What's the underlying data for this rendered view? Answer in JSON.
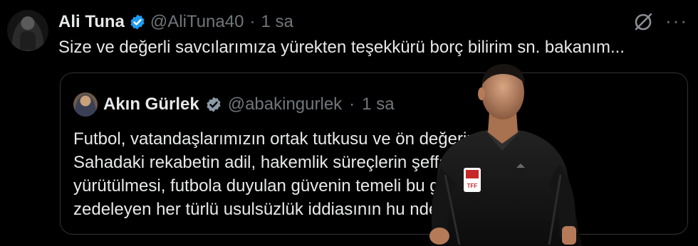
{
  "tweet": {
    "author_name": "Ali Tuna",
    "handle": "@AliTuna40",
    "separator": "·",
    "time": "1 sa",
    "text": "Size ve değerli savcılarımıza yürekten teşekkürü borç bilirim sn. bakanım...",
    "more_label": "···"
  },
  "quote": {
    "author_name": "Akın Gürlek",
    "handle": "@abakingurlek",
    "separator": "·",
    "time": "1 sa",
    "lines": [
      "Futbol, vatandaşlarımızın ortak tutkusu ve ön           değerimizdir.",
      "Sahadaki rekabetin adil, hakemlik süreçlerin              şeffaf",
      "yürütülmesi, futbola duyulan güvenin temeli               bu güveni",
      "zedeleyen her türlü usulsüzlük iddiasının hu              nde üzerine"
    ]
  },
  "icons": {
    "verified": "verified-badge-icon",
    "grok": "grok-icon",
    "more": "more-options-icon"
  },
  "colors": {
    "background": "#000000",
    "text": "#e7e9ea",
    "muted": "#71767b",
    "verified": "#1d9bf0",
    "border": "#2f3336"
  }
}
